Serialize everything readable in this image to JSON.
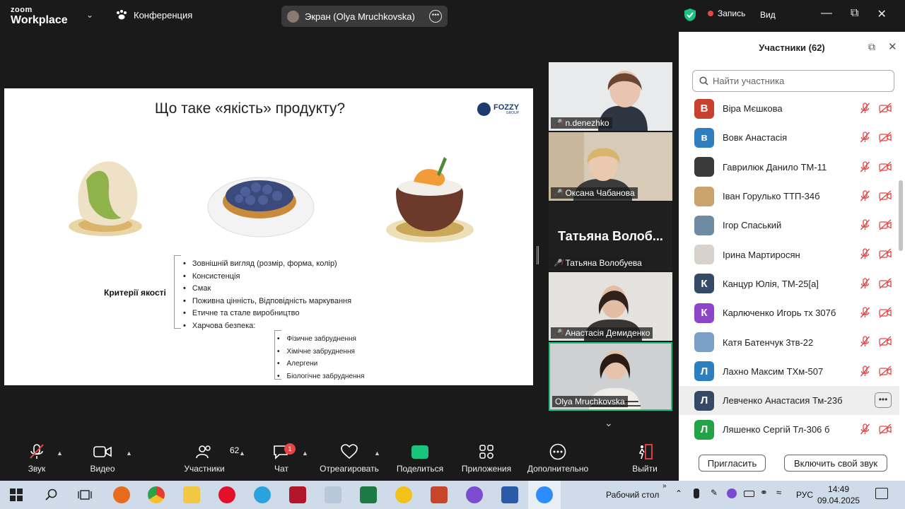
{
  "app": {
    "brand_top": "zoom",
    "brand_bottom": "Workplace",
    "meeting_label": "Конференция",
    "screen_share_label": "Экран (Olya Mruchkovska)",
    "record_label": "Запись",
    "view_label": "Вид"
  },
  "slide": {
    "title": "Що таке «якість» продукту?",
    "logo_main": "FOZZY",
    "logo_sub": "GROUP",
    "criteria_label": "Критерії якості",
    "criteria": [
      "Зовнішній вигляд  (розмір, форма, колір)",
      "Консистенція",
      "Смак",
      "Поживна цінність, Відповідність маркування",
      "Етичне та сталe виробництво",
      "Харчова безпека:"
    ],
    "safety": [
      "Фізичне забруднення",
      "Хімічне забруднення",
      "Алергени",
      "Біологічне забруднення"
    ]
  },
  "videos": [
    {
      "name": "n.denezhko"
    },
    {
      "name": "Оксана Чабанова"
    },
    {
      "name": "Татьяна Волобуева",
      "big": "Татьяна  Волоб..."
    },
    {
      "name": "Анастасія Демиденко"
    },
    {
      "name": "Olya Mruchkovska"
    }
  ],
  "panel": {
    "title": "Участники (62)",
    "search_placeholder": "Найти участника",
    "participants": [
      {
        "initial": "В",
        "name": "Віра Мєшкова",
        "color": "#c8412f"
      },
      {
        "initial": "в",
        "name": "Вовк Анастасія",
        "color": "#2e7fbf"
      },
      {
        "initial": "",
        "name": "Гаврилюк Данило ТМ-11",
        "color": "#3a3a3a"
      },
      {
        "initial": "",
        "name": "Іван Горулько ТТП-34б",
        "color": "#c9a36b"
      },
      {
        "initial": "",
        "name": "Ігор Спаський",
        "color": "#6f8aa3"
      },
      {
        "initial": "",
        "name": "Ірина Мартиросян",
        "color": "#d8d2cc"
      },
      {
        "initial": "К",
        "name": "Канцур Юлія, ТМ-25[а]",
        "color": "#354a66"
      },
      {
        "initial": "К",
        "name": "Карлюченко Игорь тх 307б",
        "color": "#8e44c9"
      },
      {
        "initial": "",
        "name": "Катя Батенчук 3тв-22",
        "color": "#7aa0c8"
      },
      {
        "initial": "Л",
        "name": "Лахно Максим ТХм-507",
        "color": "#2e7fbf"
      },
      {
        "initial": "Л",
        "name": "Левченко Анастасия Тм-23б",
        "color": "#354a66"
      },
      {
        "initial": "Л",
        "name": "Ляшенко Сергій Тл-306 б",
        "color": "#21a346"
      }
    ],
    "invite_label": "Пригласить",
    "unmute_label": "Включить свой звук"
  },
  "toolbar": {
    "audio": "Звук",
    "video": "Видео",
    "participants": "Участники",
    "participants_count": "62",
    "chat": "Чат",
    "chat_badge": "1",
    "react": "Отреагировать",
    "share": "Поделиться",
    "apps": "Приложения",
    "more": "Дополнительно",
    "leave": "Выйти"
  },
  "taskbar": {
    "desktop_label": "Рабочий стол",
    "lang": "РУС",
    "time": "14:49",
    "date": "09.04.2025"
  }
}
